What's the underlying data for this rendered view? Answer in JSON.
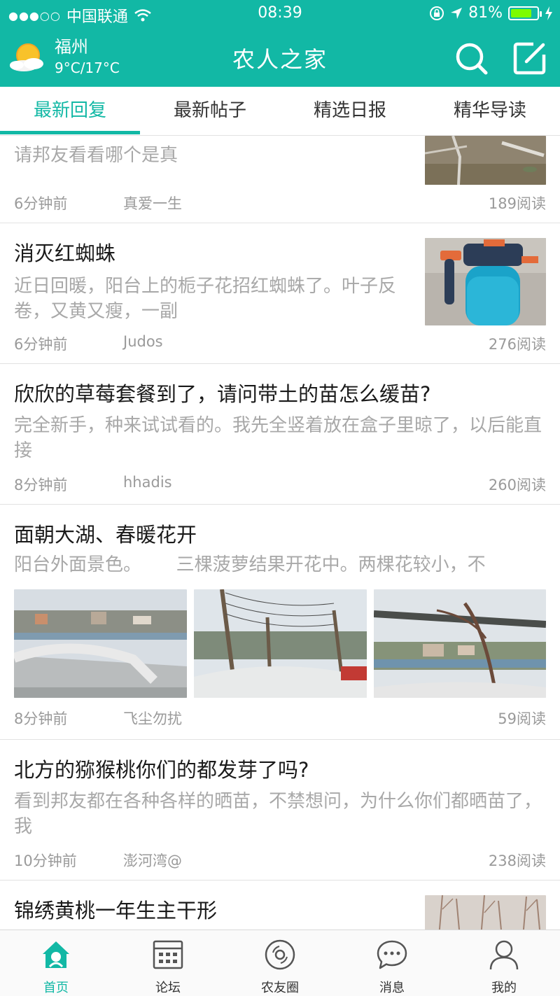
{
  "status": {
    "carrier": "中国联通",
    "time": "08:39",
    "battery": "81%",
    "battery_level": 0.81
  },
  "header": {
    "city": "福州",
    "temp": "9°C/17°C",
    "title": "农人之家",
    "search_icon": "search-icon",
    "compose_icon": "compose-icon",
    "accent": "#12b8a5"
  },
  "tabs": [
    {
      "label": "最新回复",
      "active": true
    },
    {
      "label": "最新帖子",
      "active": false
    },
    {
      "label": "精选日报",
      "active": false
    },
    {
      "label": "精华导读",
      "active": false
    }
  ],
  "posts": [
    {
      "title": "",
      "excerpt": "请邦友看看哪个是真",
      "time": "6分钟前",
      "author": "真爱一生",
      "reads": "189阅读",
      "thumb": "soil-branches-photo"
    },
    {
      "title": "消灭红蜘蛛",
      "excerpt": "近日回暖，阳台上的栀子花招红蜘蛛了。叶子反卷，又黄又瘦，一副",
      "time": "6分钟前",
      "author": "Judos",
      "reads": "276阅读",
      "thumb": "blue-spray-bottle-photo"
    },
    {
      "title": "欣欣的草莓套餐到了，请问带土的苗怎么缓苗?",
      "excerpt": "完全新手，种来试试看的。我先全竖着放在盒子里晾了，以后能直接",
      "time": "8分钟前",
      "author": "hhadis",
      "reads": "260阅读"
    },
    {
      "title": "面朝大湖、春暖花开",
      "excerpt": "阳台外面景色。      三棵菠萝结果开花中。两棵花较小，不",
      "time": "8分钟前",
      "author": "飞尘勿扰",
      "reads": "59阅读",
      "images": [
        "lake-city-photo",
        "fence-net-photo",
        "vine-lake-photo"
      ]
    },
    {
      "title": "北方的猕猴桃你们的都发芽了吗?",
      "excerpt": "看到邦友都在各种各样的晒苗，不禁想问，为什么你们都晒苗了，我",
      "time": "10分钟前",
      "author": "澎河湾@",
      "reads": "238阅读"
    },
    {
      "title": "锦绣黄桃一年生主干形",
      "excerpt": "",
      "time": "",
      "author": "",
      "reads": "",
      "thumb": "bare-trees-photo"
    }
  ],
  "tabbar": [
    {
      "label": "首页",
      "icon": "home-icon",
      "active": true
    },
    {
      "label": "论坛",
      "icon": "calendar-icon",
      "active": false
    },
    {
      "label": "农友圈",
      "icon": "disc-icon",
      "active": false
    },
    {
      "label": "消息",
      "icon": "chat-icon",
      "active": false
    },
    {
      "label": "我的",
      "icon": "user-icon",
      "active": false
    }
  ]
}
